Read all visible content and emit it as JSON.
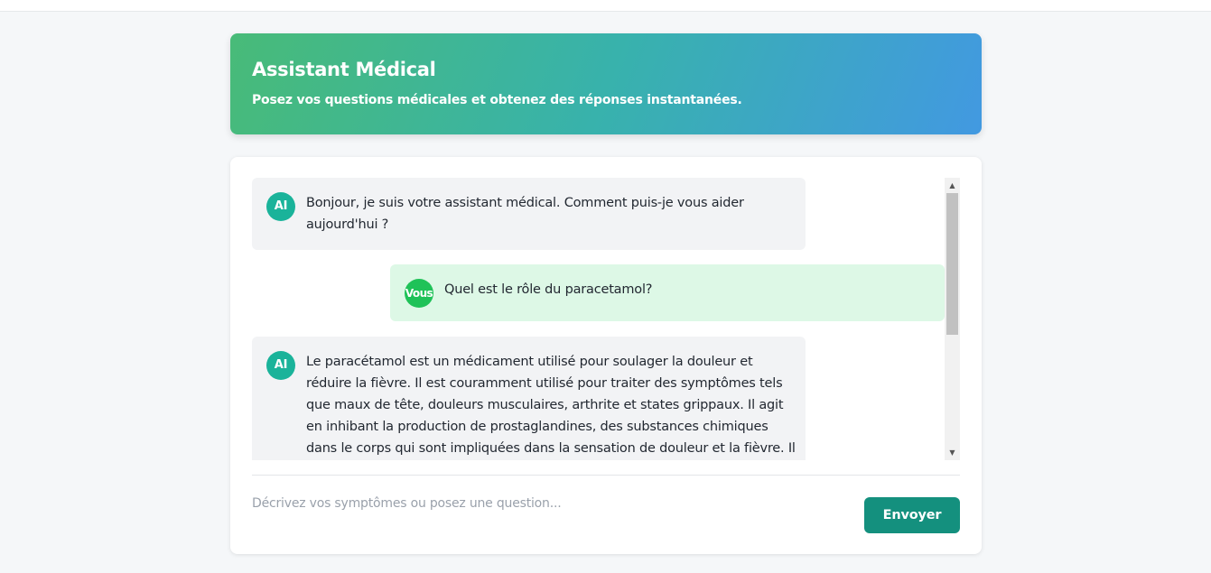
{
  "header": {
    "title": "Assistant Médical",
    "subtitle": "Posez vos questions médicales et obtenez des réponses instantanées."
  },
  "messages": [
    {
      "sender": "ai",
      "avatar": "AI",
      "text": "Bonjour, je suis votre assistant médical. Comment puis-je vous aider aujourd'hui ?"
    },
    {
      "sender": "user",
      "avatar": "Vous",
      "text": "Quel est le rôle du paracetamol?"
    },
    {
      "sender": "ai",
      "avatar": "AI",
      "text": "Le paracétamol est un médicament utilisé pour soulager la douleur et réduire la fièvre. Il est couramment utilisé pour traiter des symptômes tels que maux de tête, douleurs musculaires, arthrite et states grippaux. Il agit en inhibant la production de prostaglandines, des substances chimiques dans le corps qui sont impliquées dans la sensation de douleur et la fièvre. Il est"
    }
  ],
  "composer": {
    "placeholder": "Décrivez vos symptômes ou posez une question...",
    "send_label": "Envoyer"
  },
  "colors": {
    "gradient_start": "#48bb78",
    "gradient_end": "#4299e1",
    "ai_avatar": "#1ab39a",
    "user_avatar": "#1fc258",
    "user_bubble": "#ddf8e6",
    "ai_bubble": "#f2f3f5",
    "send_button": "#14907e"
  }
}
